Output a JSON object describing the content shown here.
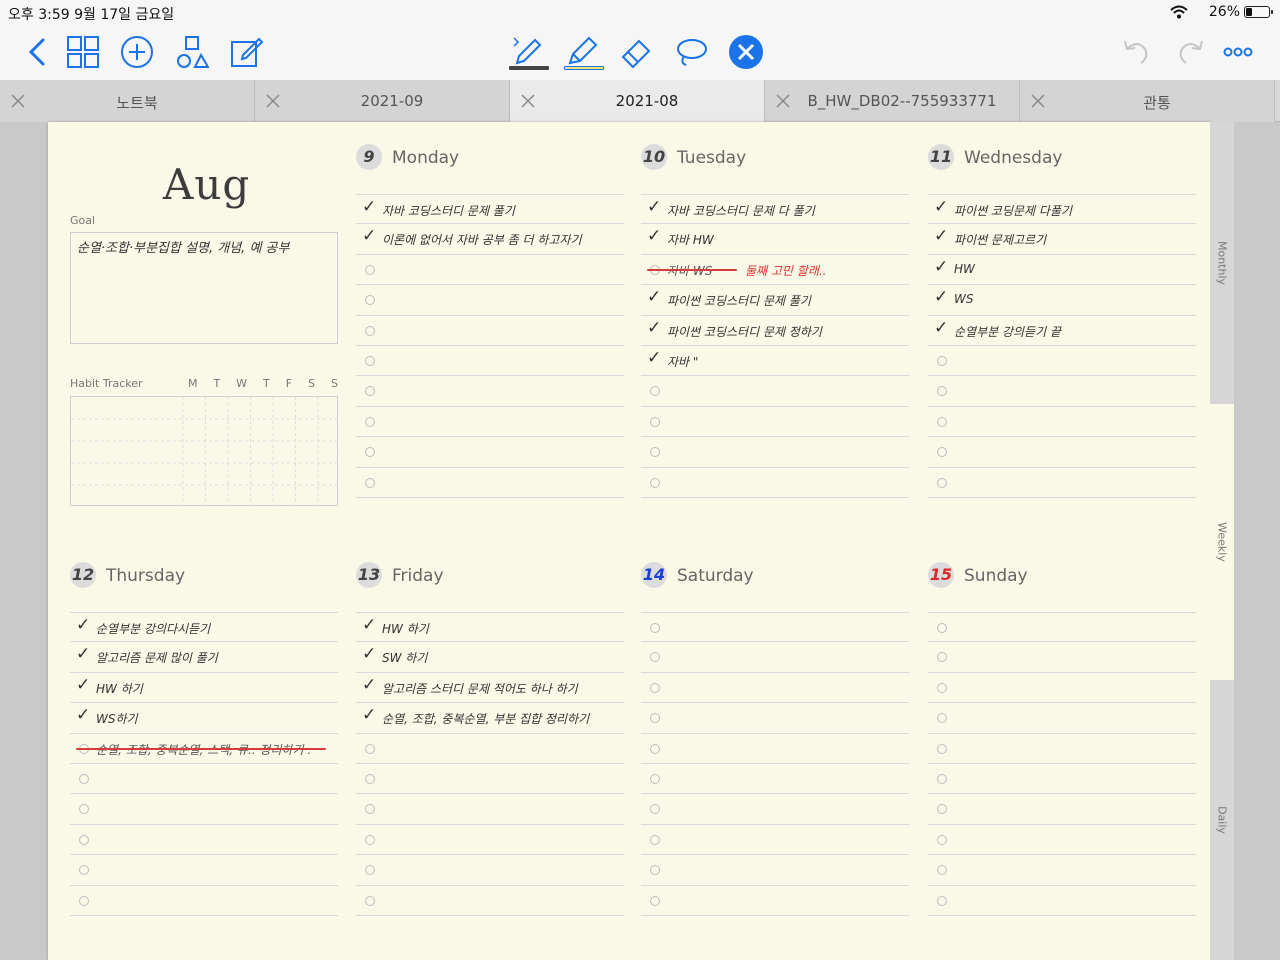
{
  "status": {
    "time": "오후 3:59  9월 17일 금요일",
    "battery": "26%",
    "battery_level": 0.26
  },
  "toolbar": {
    "left": [
      "back-icon",
      "grid-icon",
      "add-icon",
      "shapes-icon",
      "edit-icon"
    ],
    "tools": [
      "bluetooth-pen-icon",
      "highlighter-icon",
      "eraser-icon",
      "lasso-icon",
      "close-tool-icon"
    ],
    "right": [
      "undo-icon",
      "redo-icon",
      "more-icon"
    ],
    "colors": {
      "accent": "#1a73e8",
      "pen": "#444444",
      "highlighter": "#f2e36b"
    }
  },
  "tabs": [
    {
      "label": "노트북",
      "active": false
    },
    {
      "label": "2021-09",
      "active": false
    },
    {
      "label": "2021-08",
      "active": true
    },
    {
      "label": "B_HW_DB02--755933771",
      "active": false
    },
    {
      "label": "관통",
      "active": false
    }
  ],
  "planner": {
    "month": "Aug",
    "goal_label": "Goal",
    "goal_text": "순열·조합·부분집합 설명, 개념, 예 공부",
    "habit_label": "Habit Tracker",
    "habit_days": [
      "M",
      "T",
      "W",
      "T",
      "F",
      "S",
      "S"
    ],
    "days": [
      {
        "num": "9",
        "name": "Monday",
        "color": "#444444",
        "tasks": [
          {
            "check": true,
            "text": "자바 코딩스터디 문제 풀기"
          },
          {
            "check": true,
            "text": "이론에 없어서 자바 공부 좀 더 하고자기"
          }
        ]
      },
      {
        "num": "10",
        "name": "Tuesday",
        "color": "#444444",
        "tasks": [
          {
            "check": true,
            "text": "자바 코딩스터디 문제 다 풀기"
          },
          {
            "check": true,
            "text": "자바 HW"
          },
          {
            "check": false,
            "strike": true,
            "text": "자바 WS",
            "note": "둘째 고민 할래.."
          },
          {
            "check": true,
            "text": "파이썬 코딩스터디 문제 풀기"
          },
          {
            "check": true,
            "text": "파이썬 코딩스터디 문제 정하기"
          },
          {
            "check": true,
            "text": "자바           \""
          }
        ]
      },
      {
        "num": "11",
        "name": "Wednesday",
        "color": "#444444",
        "tasks": [
          {
            "check": true,
            "text": "파이썬 코딩문제 다풀기"
          },
          {
            "check": true,
            "text": "파이썬 문제고르기"
          },
          {
            "check": true,
            "text": "HW"
          },
          {
            "check": true,
            "text": "WS"
          },
          {
            "check": true,
            "text": "순열부분 강의듣기 끝"
          }
        ]
      },
      {
        "num": "12",
        "name": "Thursday",
        "color": "#444444",
        "tasks": [
          {
            "check": true,
            "text": "순열부분 강의다시듣기"
          },
          {
            "check": true,
            "text": "알고리즘 문제 많이 풀기"
          },
          {
            "check": true,
            "text": "HW 하기"
          },
          {
            "check": true,
            "text": "WS하기"
          },
          {
            "check": false,
            "strike": true,
            "text": "순열, 조합, 중복순열, 스택, 큐.. 정리하기 ."
          }
        ]
      },
      {
        "num": "13",
        "name": "Friday",
        "color": "#444444",
        "tasks": [
          {
            "check": true,
            "text": "HW 하기"
          },
          {
            "check": true,
            "text": "SW 하기"
          },
          {
            "check": true,
            "text": "알고리즘 스터디 문제 적어도 하나 하기"
          },
          {
            "check": true,
            "text": "순열, 조합, 중복순열, 부분 집합 정리하기"
          }
        ]
      },
      {
        "num": "14",
        "name": "Saturday",
        "color": "#1a3fd6",
        "tasks": []
      },
      {
        "num": "15",
        "name": "Sunday",
        "color": "#d62a2a",
        "tasks": []
      }
    ]
  },
  "side_tabs": [
    "Monthly",
    "Weekly",
    "Daily"
  ]
}
